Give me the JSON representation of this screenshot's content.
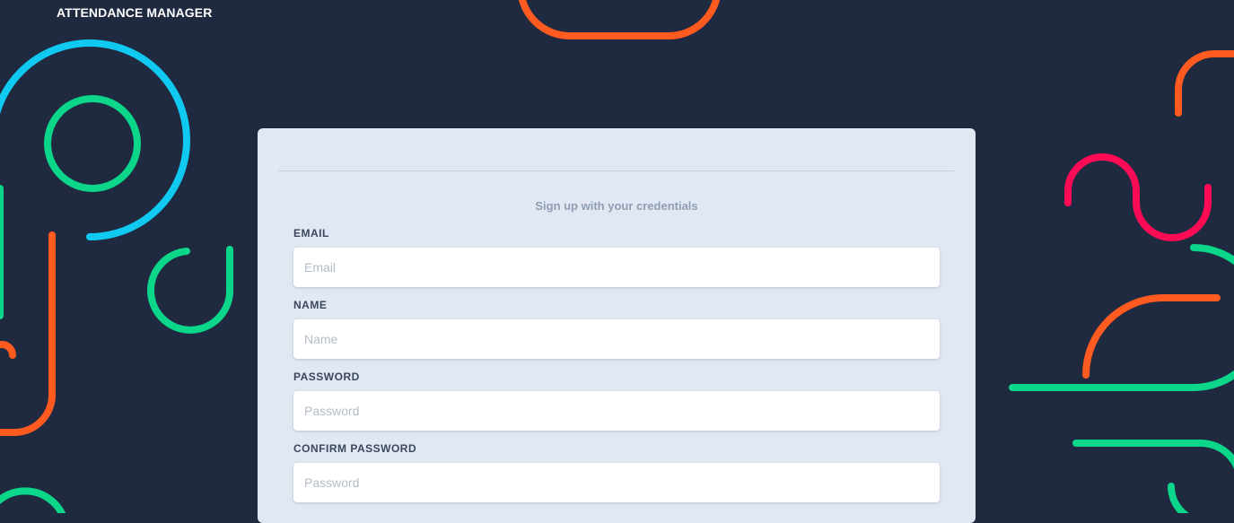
{
  "app": {
    "title": "ATTENDANCE MANAGER"
  },
  "signup_form": {
    "subtitle": "Sign up with your credentials",
    "fields": {
      "email": {
        "label": "EMAIL",
        "placeholder": "Email",
        "value": ""
      },
      "name": {
        "label": "NAME",
        "placeholder": "Name",
        "value": ""
      },
      "password": {
        "label": "PASSWORD",
        "placeholder": "Password",
        "value": ""
      },
      "confirm_password": {
        "label": "CONFIRM PASSWORD",
        "placeholder": "Password",
        "value": ""
      }
    }
  },
  "theme": {
    "background": "#1f2940",
    "card_background": "#e1e8f3",
    "decor_cyan": "#10c9f0",
    "decor_green": "#0bd68a",
    "decor_orange": "#ff5a1f",
    "decor_pink": "#ff0b55"
  }
}
